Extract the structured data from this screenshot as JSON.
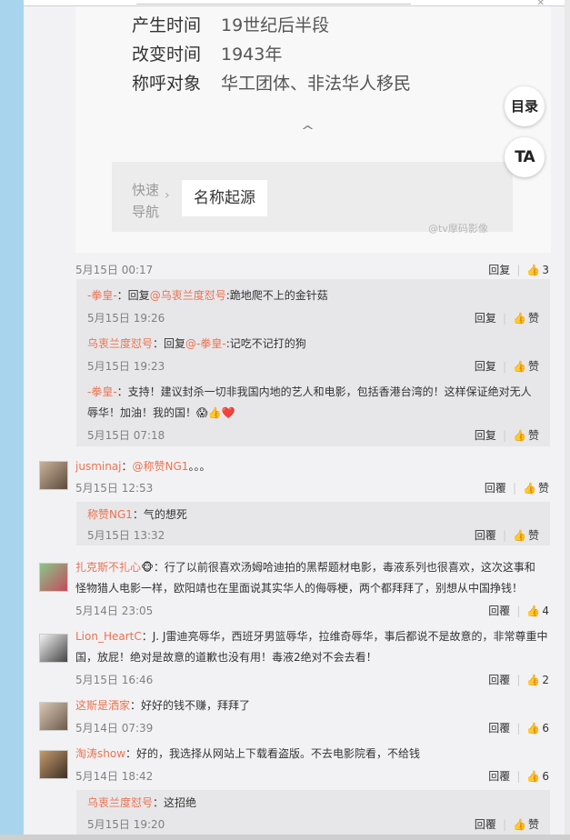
{
  "card": {
    "rows": [
      {
        "label": "产生时间",
        "value": "19世纪后半段"
      },
      {
        "label": "改变时间",
        "value": "1943年"
      },
      {
        "label": "称呼对象",
        "value": "华工团体、非法华人移民"
      }
    ],
    "toc_button": "目录",
    "ta_button": "TA",
    "quick_nav_label_1": "快速",
    "quick_nav_label_2": "导航",
    "quick_nav_item": "名称起源",
    "watermark": "@tv摩码影像"
  },
  "ui": {
    "reply": "回复",
    "reply_alt": "回覆",
    "like": "赞"
  },
  "post": {
    "time": "5月15日 00:17",
    "likes": "3"
  },
  "replies": [
    {
      "author": "-拳皇-",
      "prefix": "：回复",
      "target": "@乌衷兰度怼号",
      "text": ":跪地爬不上的金针菇",
      "time": "5月15日 19:26"
    },
    {
      "author": "乌衷兰度怼号",
      "prefix": "：回复",
      "target": "@-拳皇-",
      "text": ":记吃不记打的狗",
      "time": "5月15日 19:23"
    },
    {
      "author": "-拳皇-",
      "text1": "：支持！建议封杀一切非我国内地的艺人和电影，包括香港台湾的！这样保证绝对无人",
      "text2": "辱华！加油！我的国！😱👍❤️",
      "time": "5月15日 07:18"
    }
  ],
  "comments": [
    {
      "author": "jusminaj",
      "prefix": "：",
      "target": "@称赞NG1",
      "text": "。。。",
      "time": "5月15日 12:53",
      "likes": ""
    },
    {
      "author": "扎克斯不扎心",
      "badge": "🐵",
      "text1": "：行了以前很喜欢汤姆哈迪拍的黑帮题材电影，毒液系列也很喜欢，这次这事和",
      "text2": "怪物猎人电影一样，欧阳靖也在里面说其实华人的侮辱梗，两个都拜拜了，别想从中国挣钱！",
      "time": "5月14日 23:05",
      "likes": "4"
    },
    {
      "author": "Lion_HeartC",
      "text1": "：J. J雷迪亮辱华，西班牙男篮辱华，拉维奇辱华，事后都说不是故意的，非常尊重中",
      "text2": "国，放屁！绝对是故意的道歉也没有用！毒液2绝对不会去看！",
      "time": "5月15日 16:46",
      "likes": "2"
    },
    {
      "author": "这斯是洒家",
      "text": "：好好的钱不赚，拜拜了",
      "time": "5月14日 07:39",
      "likes": "6"
    },
    {
      "author": "淘涛show",
      "text": "：好的，我选择从网站上下载看盗版。不去电影院看，不给钱",
      "time": "5月14日 18:42",
      "likes": "6"
    }
  ],
  "sub_replies": [
    {
      "author": "称赞NG1",
      "text": "：气的想死",
      "time": "5月15日 13:32"
    },
    {
      "author": "乌衷兰度怼号",
      "text": "：这招绝",
      "time": "5月15日 19:20"
    }
  ]
}
